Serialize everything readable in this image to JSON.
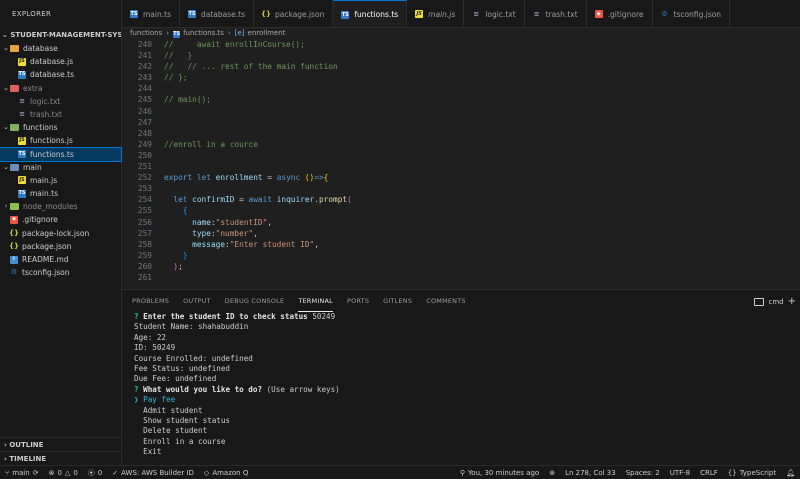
{
  "explorer": {
    "title": "EXPLORER",
    "project": "STUDENT-MANAGEMENT-SYST...",
    "items": [
      {
        "label": "database",
        "type": "folder",
        "open": true,
        "depth": 1,
        "color": "#e8a33d"
      },
      {
        "label": "database.js",
        "type": "js",
        "depth": 2
      },
      {
        "label": "database.ts",
        "type": "ts",
        "depth": 2
      },
      {
        "label": "extra",
        "type": "folder",
        "open": true,
        "depth": 1,
        "color": "#e36060",
        "dim": true
      },
      {
        "label": "logic.txt",
        "type": "txt",
        "depth": 2,
        "dim": true
      },
      {
        "label": "trash.txt",
        "type": "txt",
        "depth": 2,
        "dim": true
      },
      {
        "label": "functions",
        "type": "folder",
        "open": true,
        "depth": 1,
        "color": "#7fb35a"
      },
      {
        "label": "functions.js",
        "type": "js",
        "depth": 2
      },
      {
        "label": "functions.ts",
        "type": "ts",
        "depth": 2,
        "active": true
      },
      {
        "label": "main",
        "type": "folder",
        "open": true,
        "depth": 1,
        "color": "#6c8ebf"
      },
      {
        "label": "main.js",
        "type": "js",
        "depth": 2
      },
      {
        "label": "main.ts",
        "type": "ts",
        "depth": 2
      },
      {
        "label": "node_modules",
        "type": "folder",
        "open": false,
        "depth": 1,
        "color": "#8bc34a",
        "dim": true
      },
      {
        "label": ".gitignore",
        "type": "git",
        "depth": 1
      },
      {
        "label": "package-lock.json",
        "type": "json",
        "depth": 1
      },
      {
        "label": "package.json",
        "type": "json",
        "depth": 1
      },
      {
        "label": "README.md",
        "type": "info",
        "depth": 1
      },
      {
        "label": "tsconfig.json",
        "type": "tsconfig",
        "depth": 1
      }
    ],
    "outline": "OUTLINE",
    "timeline": "TIMELINE"
  },
  "tabs": [
    {
      "label": "main.ts",
      "type": "ts"
    },
    {
      "label": "database.ts",
      "type": "ts"
    },
    {
      "label": "package.json",
      "type": "json"
    },
    {
      "label": "functions.ts",
      "type": "ts",
      "active": true
    },
    {
      "label": "main.js",
      "type": "js",
      "italic": true
    },
    {
      "label": "logic.txt",
      "type": "txt"
    },
    {
      "label": "trash.txt",
      "type": "txt"
    },
    {
      "label": ".gitignore",
      "type": "git"
    },
    {
      "label": "tsconfig.json",
      "type": "tsconfig"
    }
  ],
  "breadcrumb": [
    "functions",
    "functions.ts",
    "enrollment"
  ],
  "code": [
    {
      "n": "240",
      "t": [
        [
          "//     await enrollInCourse();",
          "c-com"
        ]
      ]
    },
    {
      "n": "241",
      "t": [
        [
          "//   }",
          "c-com"
        ]
      ]
    },
    {
      "n": "242",
      "t": [
        [
          "//   // ... rest of the main function",
          "c-com"
        ]
      ]
    },
    {
      "n": "243",
      "t": [
        [
          "// };",
          "c-com"
        ]
      ]
    },
    {
      "n": "244",
      "t": []
    },
    {
      "n": "245",
      "t": [
        [
          "// main();",
          "c-com"
        ]
      ]
    },
    {
      "n": "246",
      "t": []
    },
    {
      "n": "247",
      "t": []
    },
    {
      "n": "248",
      "t": []
    },
    {
      "n": "249",
      "t": [
        [
          "//enroll in a cource",
          "c-com"
        ]
      ]
    },
    {
      "n": "250",
      "t": []
    },
    {
      "n": "251",
      "t": []
    },
    {
      "n": "252",
      "t": [
        [
          "export ",
          "c-kw"
        ],
        [
          "let ",
          "c-kw"
        ],
        [
          "enrollment",
          "c-var"
        ],
        [
          " = ",
          "code"
        ],
        [
          "async ",
          "c-kw"
        ],
        [
          "()",
          "c-br1"
        ],
        [
          "=>",
          "c-kw"
        ],
        [
          "{",
          "c-br1"
        ]
      ]
    },
    {
      "n": "253",
      "t": []
    },
    {
      "n": "254",
      "t": [
        [
          "  let ",
          "c-kw"
        ],
        [
          "confirmID",
          "c-var"
        ],
        [
          " = ",
          "code"
        ],
        [
          "await ",
          "c-kw"
        ],
        [
          "inquirer",
          "c-var"
        ],
        [
          ".",
          "code"
        ],
        [
          "prompt",
          "c-fn"
        ],
        [
          "(",
          "c-br2"
        ]
      ]
    },
    {
      "n": "255",
      "t": [
        [
          "    {",
          "c-br3"
        ]
      ]
    },
    {
      "n": "256",
      "t": [
        [
          "      name",
          "c-var"
        ],
        [
          ":",
          "code"
        ],
        [
          "\"studentID\"",
          "c-str"
        ],
        [
          ",",
          "code"
        ]
      ]
    },
    {
      "n": "257",
      "t": [
        [
          "      type",
          "c-var"
        ],
        [
          ":",
          "code"
        ],
        [
          "\"number\"",
          "c-str"
        ],
        [
          ",",
          "code"
        ]
      ]
    },
    {
      "n": "258",
      "t": [
        [
          "      message",
          "c-var"
        ],
        [
          ":",
          "code"
        ],
        [
          "\"Enter student ID\"",
          "c-str"
        ],
        [
          ",",
          "code"
        ]
      ]
    },
    {
      "n": "259",
      "t": [
        [
          "    }",
          "c-br3"
        ]
      ]
    },
    {
      "n": "260",
      "t": [
        [
          "  )",
          "c-br2"
        ],
        [
          ";",
          "code"
        ]
      ]
    },
    {
      "n": "261",
      "t": []
    }
  ],
  "panel": {
    "tabs": [
      "PROBLEMS",
      "OUTPUT",
      "DEBUG CONSOLE",
      "TERMINAL",
      "PORTS",
      "GITLENS",
      "COMMENTS"
    ],
    "active_tab": "TERMINAL",
    "shell": "cmd",
    "add": "+"
  },
  "terminal": [
    [
      [
        "? ",
        "q"
      ],
      [
        "Enter the student ID to check status ",
        "bold"
      ],
      [
        "50249",
        "dim"
      ]
    ],
    [
      [
        "Student Name: shahabuddin",
        "dim"
      ]
    ],
    [
      [
        "Age: 22",
        "dim"
      ]
    ],
    [
      [
        "ID: 50249",
        "dim"
      ]
    ],
    [
      [
        "Course Enrolled: undefined",
        "dim"
      ]
    ],
    [
      [
        "Fee Status: undefined",
        "dim"
      ]
    ],
    [
      [
        "Due Fee: undefined",
        "dim"
      ]
    ],
    [
      [
        "? ",
        "q"
      ],
      [
        "What would you like to do? ",
        "bold"
      ],
      [
        "(Use arrow keys)",
        "dim"
      ]
    ],
    [
      [
        "❯ Pay fee",
        "sel"
      ]
    ],
    [
      [
        "  Admit student",
        "dim"
      ]
    ],
    [
      [
        "  Show student status",
        "dim"
      ]
    ],
    [
      [
        "  Delete student",
        "dim"
      ]
    ],
    [
      [
        "  Enroll in a course",
        "dim"
      ]
    ],
    [
      [
        "  Exit",
        "dim"
      ]
    ]
  ],
  "status": {
    "branch": "main",
    "errors": "0",
    "warnings": "0",
    "ports": "0",
    "aws": "AWS: AWS Builder ID",
    "amazonq": "Amazon Q",
    "blame": "You, 30 minutes ago",
    "position": "Ln 278, Col 33",
    "spaces": "Spaces: 2",
    "encoding": "UTF-8",
    "eol": "CRLF",
    "language": "TypeScript"
  },
  "colors": {
    "accent": "#0078d4",
    "ts": "#3178c6",
    "js": "#f1dd35",
    "json": "#cbcb41",
    "git": "#e8553d"
  }
}
